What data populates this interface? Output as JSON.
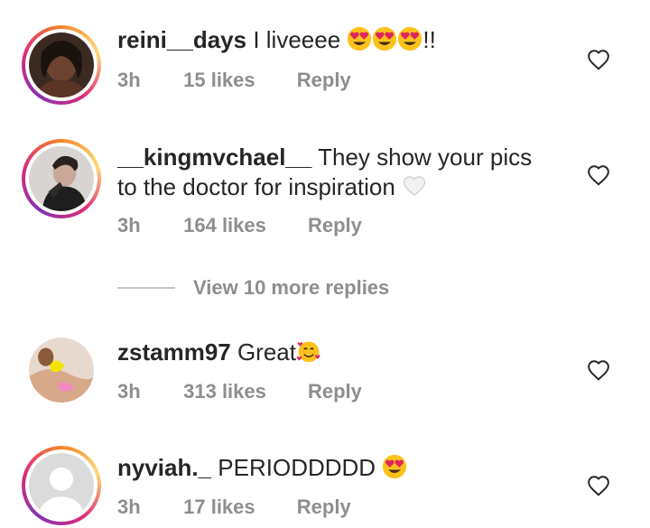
{
  "comments": [
    {
      "username": "reini__days",
      "text": " I liveeee ",
      "emoji": [
        "heart-eyes",
        "heart-eyes",
        "heart-eyes"
      ],
      "suffix": "!!",
      "time": "3h",
      "likes": "15 likes",
      "reply": "Reply",
      "has_story_ring": true
    },
    {
      "username": "__kingmvchael__",
      "text": " They show your pics to the doctor for inspiration ",
      "emoji": [
        "white-heart"
      ],
      "suffix": "",
      "time": "3h",
      "likes": "164 likes",
      "reply": "Reply",
      "has_story_ring": true
    },
    {
      "username": "zstamm97",
      "text": " Great",
      "emoji": [
        "smiling-face-with-hearts"
      ],
      "suffix": "",
      "time": "3h",
      "likes": "313 likes",
      "reply": "Reply",
      "has_story_ring": false
    },
    {
      "username": "nyviah._",
      "text": " PERIODDDDD ",
      "emoji": [
        "heart-eyes"
      ],
      "suffix": "",
      "time": "3h",
      "likes": "17 likes",
      "reply": "Reply",
      "has_story_ring": true
    }
  ],
  "view_more": "View 10 more replies",
  "colors": {
    "text": "#262626",
    "muted": "#8e8e8e",
    "ring_start": "#f58529",
    "ring_mid": "#dd2a7b",
    "ring_end": "#8134af"
  },
  "icons": {
    "like": "heart-outline-icon"
  }
}
